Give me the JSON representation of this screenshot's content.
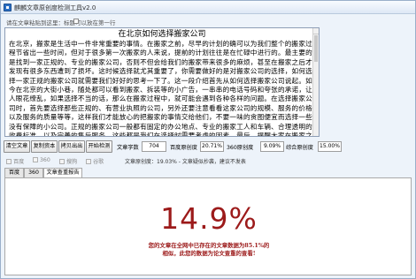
{
  "window": {
    "title": "麒麟文章原创度检测工具v2.0"
  },
  "top_row": {
    "label": "请在文章粘贴到这里：标题可以放在第一行",
    "checkbox": ""
  },
  "editor": {
    "title": "在北京如何选择搬家公司",
    "body": "在北京，搬家是生活中一件非常重要的事情。在搬家之前，尽早的计划的确可以为我们整个的搬家过程节省出一些时间，但对于很多第一次搬家的人来说，提前的计划往往是在忙碌中进行的。最主要的是找到一家正规的、专业的搬家公司，否则不但会给我们的搬家带来很多的麻烦，甚至在搬家之后才发现有很多东西遭到了损坏。这时候选择就尤其重要了，你需要做好的是对搬家公司的选择，如何选择一家正规的搬家公司就需要我们好好的思考一下了。这一段介绍首先从如何选择搬家公司说起。如今在北京的大街小巷，随处都可以看到搬家、拆装等的小广告，一串串的电话号码和夸张的承诺，让人眼花缭乱，如果选择不当的话，那么在搬家过程中，就可能会遇到各种各样的问题。在选择搬家公司时，首先要选择那些正规的、有营业执照的公司，另外还要注意看看这家公司的规模、服务的价格以及服务的质量等等，这样我们才能放心的把搬家的事情交给他们，不要一味的贪图便宜而选择一些没有保障的小公司。正规的搬家公司一般都有固定的办公地点、专业的搬家工人和车辆、合理透明的收费标准，以及完善的售后服务，这些都是我们在选择时需要考虑的因素。最后，提醒大家在搬家之前一定要和搬家公司签订好合同，明确双方的责任和义务，这样在出现问题的时候才能有据可查，维护好自己的合法权益。"
  },
  "toolbar": {
    "buttons": [
      "清空文章",
      "复制资本",
      "拷贝出出",
      "开始检测"
    ],
    "stats": [
      {
        "label": "文章字数",
        "value": "704"
      },
      {
        "label": "百度原创度",
        "value": "20.71%"
      },
      {
        "label": "360原创度",
        "value": "9.09%"
      },
      {
        "label": "综合原创度",
        "value": "15.00%"
      }
    ]
  },
  "options_row": {
    "checkboxes": [
      "百度",
      "360",
      "搜狗",
      "谷歌"
    ],
    "summary": "文章原创度：19.03% - 文章疑似抄袭，建议不发表"
  },
  "tabs": [
    "百度",
    "360",
    "文章查重报告"
  ],
  "result": {
    "percent": "14.9%",
    "note1": "您的文章在全网中已存在的文章数据为85.1%的",
    "note2": "相似，此您的数据为论文查重的查看!"
  }
}
